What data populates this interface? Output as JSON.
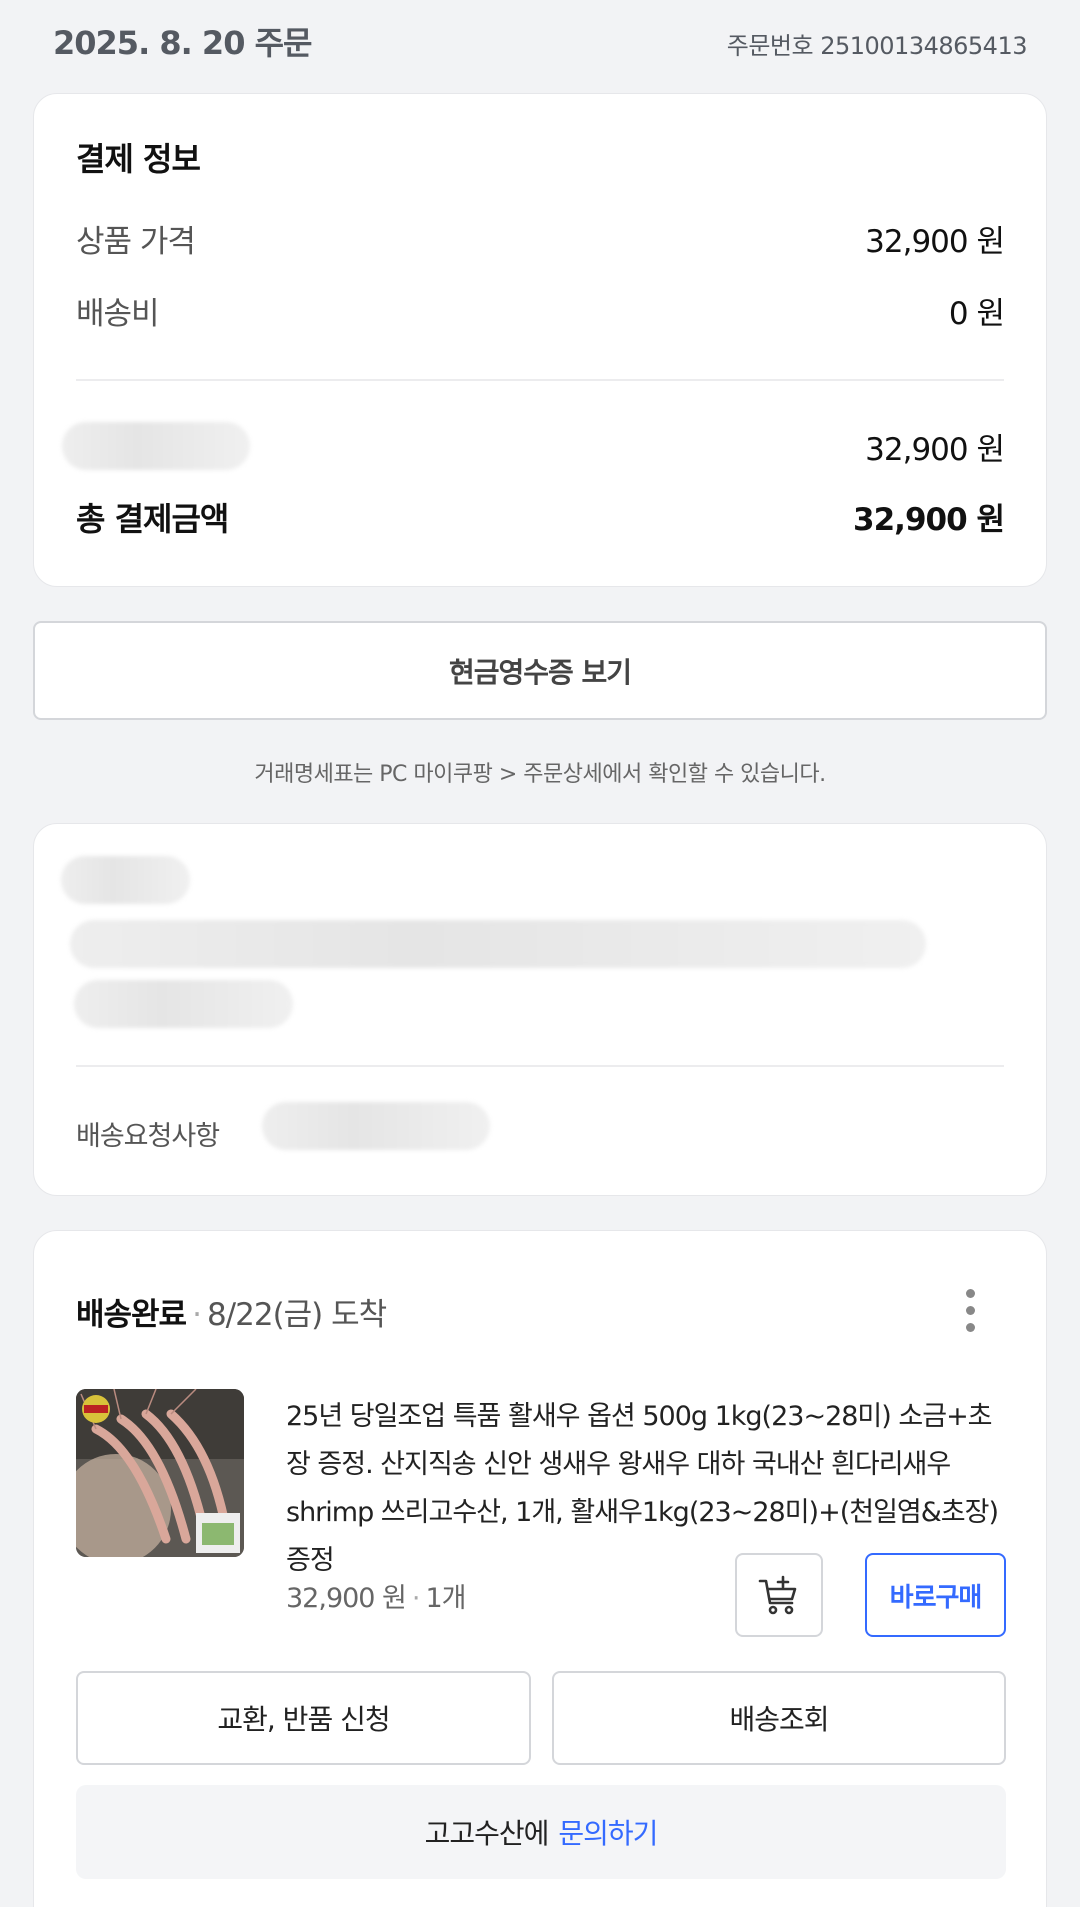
{
  "order": {
    "date": "2025. 8. 20 주문",
    "number": "주문번호 25100134865413"
  },
  "payment": {
    "title": "결제 정보",
    "item_price_label": "상품 가격",
    "item_price_value": "32,900 원",
    "shipping_label": "배송비",
    "shipping_value": "0 원",
    "method_value": "32,900 원",
    "total_label": "총 결제금액",
    "total_value": "32,900 원"
  },
  "receipt": {
    "button_label": "현금영수증 보기",
    "note": "거래명세표는 PC 마이쿠팡 > 주문상세에서 확인할 수 있습니다."
  },
  "delivery_info": {
    "request_label": "배송요청사항"
  },
  "shipment": {
    "status": "배송완료",
    "arrival": "8/22(금) 도착",
    "product_name": "25년 당일조업 특품 활새우 옵션 500g 1kg(23~28미) 소금+초장 증정. 산지직송 신안 생새우 왕새우 대하 국내산 흰다리새우 shrimp 쓰리고수산, 1개, 활새우1kg(23~28미)+(천일염&초장)증정",
    "price": "32,900 원",
    "quantity": "1개",
    "buy_now_label": "바로구매",
    "exchange_return_label": "교환, 반품 신청",
    "track_label": "배송조회",
    "seller_prefix": "고고수산에",
    "inquiry_link": "문의하기"
  },
  "colors": {
    "accent": "#346aff",
    "background": "#f2f3f5",
    "card": "#ffffff"
  },
  "icons": [
    "kebab-menu-icon",
    "add-to-cart-icon"
  ]
}
